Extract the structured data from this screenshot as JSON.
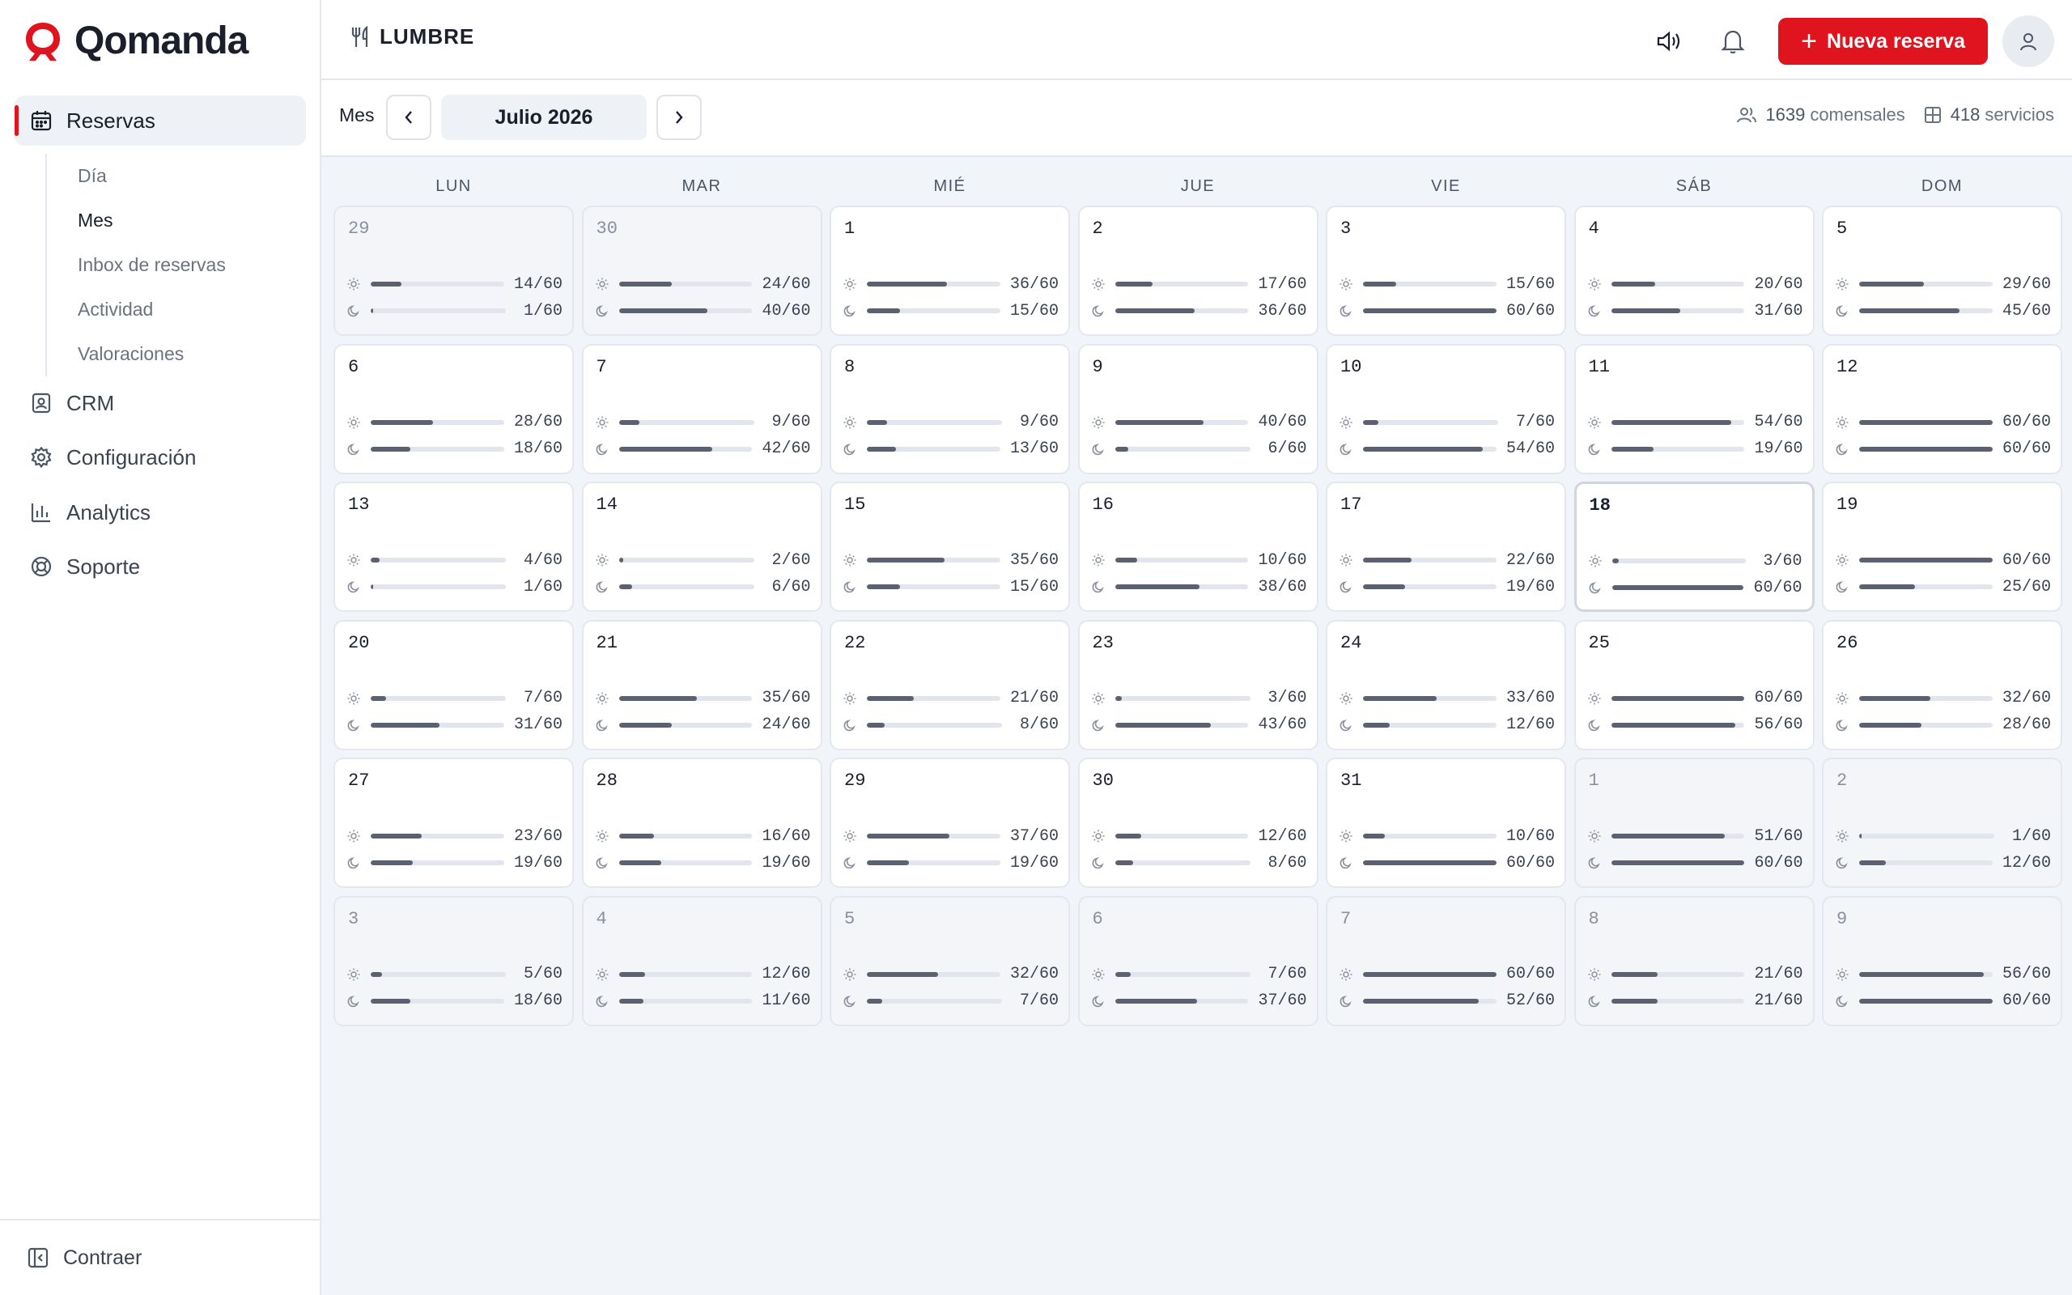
{
  "brand": {
    "name": "Qomanda",
    "accent": "#e0141e"
  },
  "sidebar": {
    "active": {
      "label": "Reservas",
      "icon": "calendar-icon"
    },
    "subitems": [
      {
        "label": "Día",
        "active": false
      },
      {
        "label": "Mes",
        "active": true
      },
      {
        "label": "Inbox de reservas",
        "active": false
      },
      {
        "label": "Actividad",
        "active": false
      },
      {
        "label": "Valoraciones",
        "active": false
      }
    ],
    "items": [
      {
        "label": "CRM",
        "icon": "contact-card-icon"
      },
      {
        "label": "Configuración",
        "icon": "gear-icon"
      },
      {
        "label": "Analytics",
        "icon": "bar-chart-icon"
      },
      {
        "label": "Soporte",
        "icon": "lifebuoy-icon"
      }
    ],
    "collapse_label": "Contraer"
  },
  "header": {
    "restaurant": "LUMBRE",
    "new_button": "Nueva reserva"
  },
  "toolbar": {
    "view": "Mes",
    "month": "Julio 2026",
    "guests_num": "1639",
    "guests_label": "comensales",
    "services_num": "418",
    "services_label": "servicios"
  },
  "calendar": {
    "weekdays": [
      "LUN",
      "MAR",
      "MIÉ",
      "JUE",
      "VIE",
      "SÁB",
      "DOM"
    ],
    "capacity": 60,
    "days": [
      {
        "day": "29",
        "outside": true,
        "lunch": 14,
        "dinner": 1
      },
      {
        "day": "30",
        "outside": true,
        "lunch": 24,
        "dinner": 40
      },
      {
        "day": "1",
        "lunch": 36,
        "dinner": 15
      },
      {
        "day": "2",
        "lunch": 17,
        "dinner": 36
      },
      {
        "day": "3",
        "lunch": 15,
        "dinner": 60
      },
      {
        "day": "4",
        "lunch": 20,
        "dinner": 31
      },
      {
        "day": "5",
        "lunch": 29,
        "dinner": 45
      },
      {
        "day": "6",
        "lunch": 28,
        "dinner": 18
      },
      {
        "day": "7",
        "lunch": 9,
        "dinner": 42
      },
      {
        "day": "8",
        "lunch": 9,
        "dinner": 13
      },
      {
        "day": "9",
        "lunch": 40,
        "dinner": 6
      },
      {
        "day": "10",
        "lunch": 7,
        "dinner": 54
      },
      {
        "day": "11",
        "lunch": 54,
        "dinner": 19
      },
      {
        "day": "12",
        "lunch": 60,
        "dinner": 60
      },
      {
        "day": "13",
        "lunch": 4,
        "dinner": 1
      },
      {
        "day": "14",
        "lunch": 2,
        "dinner": 6
      },
      {
        "day": "15",
        "lunch": 35,
        "dinner": 15
      },
      {
        "day": "16",
        "lunch": 10,
        "dinner": 38
      },
      {
        "day": "17",
        "lunch": 22,
        "dinner": 19
      },
      {
        "day": "18",
        "today": true,
        "lunch": 3,
        "dinner": 60
      },
      {
        "day": "19",
        "lunch": 60,
        "dinner": 25
      },
      {
        "day": "20",
        "lunch": 7,
        "dinner": 31
      },
      {
        "day": "21",
        "lunch": 35,
        "dinner": 24
      },
      {
        "day": "22",
        "lunch": 21,
        "dinner": 8
      },
      {
        "day": "23",
        "lunch": 3,
        "dinner": 43
      },
      {
        "day": "24",
        "lunch": 33,
        "dinner": 12
      },
      {
        "day": "25",
        "lunch": 60,
        "dinner": 56
      },
      {
        "day": "26",
        "lunch": 32,
        "dinner": 28
      },
      {
        "day": "27",
        "lunch": 23,
        "dinner": 19
      },
      {
        "day": "28",
        "lunch": 16,
        "dinner": 19
      },
      {
        "day": "29",
        "lunch": 37,
        "dinner": 19
      },
      {
        "day": "30",
        "lunch": 12,
        "dinner": 8
      },
      {
        "day": "31",
        "lunch": 10,
        "dinner": 60
      },
      {
        "day": "1",
        "outside": true,
        "lunch": 51,
        "dinner": 60
      },
      {
        "day": "2",
        "outside": true,
        "lunch": 1,
        "dinner": 12
      },
      {
        "day": "3",
        "outside": true,
        "lunch": 5,
        "dinner": 18
      },
      {
        "day": "4",
        "outside": true,
        "lunch": 12,
        "dinner": 11
      },
      {
        "day": "5",
        "outside": true,
        "lunch": 32,
        "dinner": 7
      },
      {
        "day": "6",
        "outside": true,
        "lunch": 7,
        "dinner": 37
      },
      {
        "day": "7",
        "outside": true,
        "lunch": 60,
        "dinner": 52
      },
      {
        "day": "8",
        "outside": true,
        "lunch": 21,
        "dinner": 21
      },
      {
        "day": "9",
        "outside": true,
        "lunch": 56,
        "dinner": 60
      }
    ]
  }
}
